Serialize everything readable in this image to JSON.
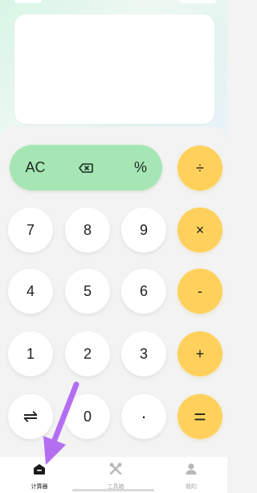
{
  "keypad": {
    "top_row": {
      "clear": "AC",
      "backspace_icon": "backspace-icon",
      "percent": "%",
      "divide": "÷"
    },
    "rows": [
      {
        "keys": [
          "7",
          "8",
          "9"
        ],
        "op": "×"
      },
      {
        "keys": [
          "4",
          "5",
          "6"
        ],
        "op": "-"
      },
      {
        "keys": [
          "1",
          "2",
          "3"
        ],
        "op": "+"
      }
    ],
    "bottom_row": {
      "swap": "⇌",
      "zero": "0",
      "dot": "·",
      "equals": "="
    }
  },
  "tabbar": {
    "items": [
      {
        "label": "计算器",
        "icon": "home-icon",
        "active": true
      },
      {
        "label": "工具箱",
        "icon": "tools-icon",
        "active": false
      },
      {
        "label": "我的",
        "icon": "user-icon",
        "active": false
      }
    ]
  },
  "colors": {
    "accent_green": "#a6e6b5",
    "accent_yellow": "#ffd15c",
    "annotation_arrow": "#b46ef2"
  }
}
